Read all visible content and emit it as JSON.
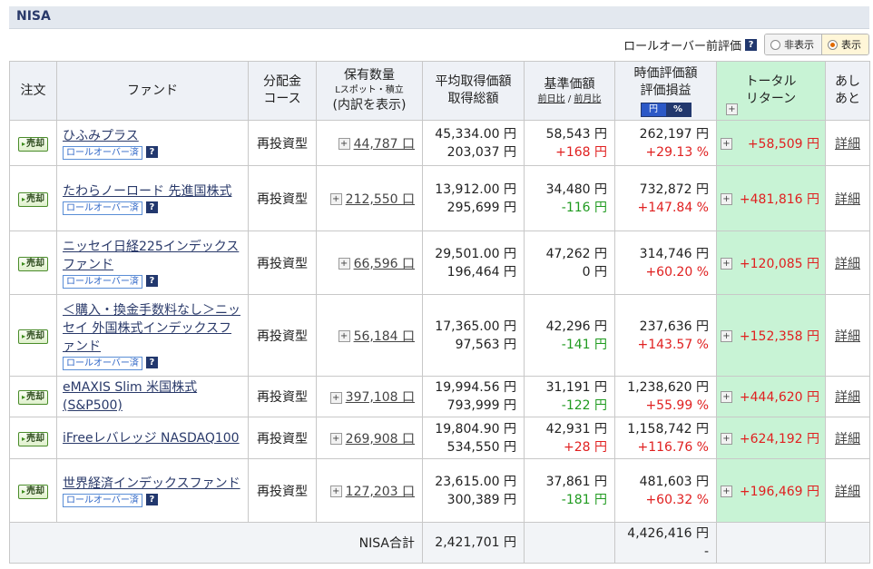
{
  "section_title": "NISA",
  "rollover_toggle": {
    "label": "ロールオーバー前評価",
    "help": "?",
    "options": [
      "非表示",
      "表示"
    ],
    "selected": "表示"
  },
  "columns": {
    "order": "注文",
    "fund": "ファンド",
    "course_l1": "分配金",
    "course_l2": "コース",
    "qty_l1": "保有数量",
    "qty_l2": "Lスポット・積立",
    "qty_l3": "(内訳を表示)",
    "avg_l1": "平均取得価額",
    "avg_l2": "取得総額",
    "base_l1": "基準価額",
    "base_l2a": "前日比",
    "base_sep": "/",
    "base_l2b": "前月比",
    "value_l1": "時価評価額",
    "value_l2": "評価損益",
    "yen_toggle": "円",
    "pct_toggle": "%",
    "total_l1": "トータル",
    "total_l2": "リターン",
    "history_l1": "あし",
    "history_l2": "あと"
  },
  "sell_label": "売却",
  "rollover_badge": "ロールオーバー済",
  "help_mark": "?",
  "detail_label": "詳細",
  "rows": [
    {
      "fund": "ひふみプラス",
      "rollover": true,
      "course": "再投資型",
      "qty": "44,787 口",
      "avg_price": "45,334.00 円",
      "total_cost": "203,037 円",
      "base_price": "58,543 円",
      "base_change": "+168 円",
      "base_dir": "up",
      "market_value": "262,197 円",
      "pnl": "+29.13 %",
      "total_return": "+58,509 円"
    },
    {
      "fund": "たわらノーロード 先進国株式",
      "rollover": true,
      "course": "再投資型",
      "qty": "212,550 口",
      "avg_price": "13,912.00 円",
      "total_cost": "295,699 円",
      "base_price": "34,480 円",
      "base_change": "-116 円",
      "base_dir": "down",
      "market_value": "732,872 円",
      "pnl": "+147.84 %",
      "total_return": "+481,816 円"
    },
    {
      "fund": "ニッセイ日経225インデックスファンド",
      "rollover": true,
      "course": "再投資型",
      "qty": "66,596 口",
      "avg_price": "29,501.00 円",
      "total_cost": "196,464 円",
      "base_price": "47,262 円",
      "base_change": "0 円",
      "base_dir": "flat",
      "market_value": "314,746 円",
      "pnl": "+60.20 %",
      "total_return": "+120,085 円"
    },
    {
      "fund": "＜購入・換金手数料なし＞ニッセイ 外国株式インデックスファンド",
      "rollover": true,
      "course": "再投資型",
      "qty": "56,184 口",
      "avg_price": "17,365.00 円",
      "total_cost": "97,563 円",
      "base_price": "42,296 円",
      "base_change": "-141 円",
      "base_dir": "down",
      "market_value": "237,636 円",
      "pnl": "+143.57 %",
      "total_return": "+152,358 円"
    },
    {
      "fund": "eMAXIS Slim 米国株式(S&P500)",
      "rollover": false,
      "course": "再投資型",
      "qty": "397,108 口",
      "avg_price": "19,994.56 円",
      "total_cost": "793,999 円",
      "base_price": "31,191 円",
      "base_change": "-122 円",
      "base_dir": "down",
      "market_value": "1,238,620 円",
      "pnl": "+55.99 %",
      "total_return": "+444,620 円"
    },
    {
      "fund": "iFreeレバレッジ NASDAQ100",
      "rollover": false,
      "course": "再投資型",
      "qty": "269,908 口",
      "avg_price": "19,804.90 円",
      "total_cost": "534,550 円",
      "base_price": "42,931 円",
      "base_change": "+28 円",
      "base_dir": "up",
      "market_value": "1,158,742 円",
      "pnl": "+116.76 %",
      "total_return": "+624,192 円"
    },
    {
      "fund": "世界経済インデックスファンド",
      "rollover": true,
      "course": "再投資型",
      "qty": "127,203 口",
      "avg_price": "23,615.00 円",
      "total_cost": "300,389 円",
      "base_price": "37,861 円",
      "base_change": "-181 円",
      "base_dir": "down",
      "market_value": "481,603 円",
      "pnl": "+60.32 %",
      "total_return": "+196,469 円"
    }
  ],
  "summary": {
    "label": "NISA合計",
    "total_cost": "2,421,701 円",
    "market_value": "4,426,416 円",
    "pnl": "-"
  },
  "colors": {
    "positive": "#e02020",
    "negative": "#1f9a1f",
    "total_return_bg": "#c8f3d5"
  }
}
